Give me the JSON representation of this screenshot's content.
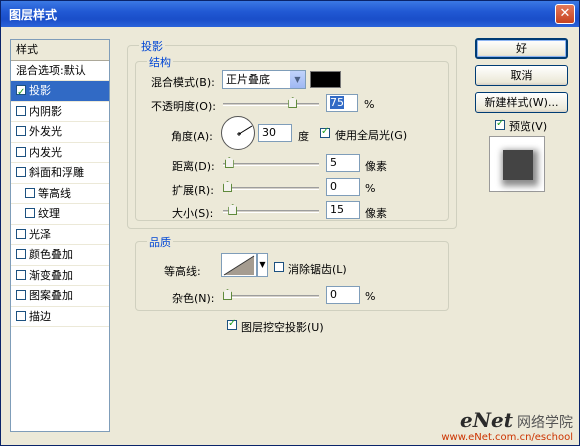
{
  "window": {
    "title": "图层样式",
    "close_glyph": "✕"
  },
  "style_list": {
    "header": "样式",
    "blend_options": "混合选项:默认",
    "items": [
      {
        "label": "投影",
        "checked": true,
        "selected": true,
        "sub": false
      },
      {
        "label": "内阴影",
        "checked": false,
        "selected": false,
        "sub": false
      },
      {
        "label": "外发光",
        "checked": false,
        "selected": false,
        "sub": false
      },
      {
        "label": "内发光",
        "checked": false,
        "selected": false,
        "sub": false
      },
      {
        "label": "斜面和浮雕",
        "checked": false,
        "selected": false,
        "sub": false
      },
      {
        "label": "等高线",
        "checked": false,
        "selected": false,
        "sub": true
      },
      {
        "label": "纹理",
        "checked": false,
        "selected": false,
        "sub": true
      },
      {
        "label": "光泽",
        "checked": false,
        "selected": false,
        "sub": false
      },
      {
        "label": "颜色叠加",
        "checked": false,
        "selected": false,
        "sub": false
      },
      {
        "label": "渐变叠加",
        "checked": false,
        "selected": false,
        "sub": false
      },
      {
        "label": "图案叠加",
        "checked": false,
        "selected": false,
        "sub": false
      },
      {
        "label": "描边",
        "checked": false,
        "selected": false,
        "sub": false
      }
    ]
  },
  "drop_shadow": {
    "title": "投影",
    "structure_title": "结构",
    "blend_mode": {
      "label": "混合模式(B):",
      "value": "正片叠底",
      "color": "#000000"
    },
    "opacity": {
      "label": "不透明度(O):",
      "value": "75",
      "unit": "%",
      "level": 0.75
    },
    "angle": {
      "label": "角度(A):",
      "value": "30",
      "unit": "度",
      "global_light_label": "使用全局光(G)",
      "global_light": true
    },
    "distance": {
      "label": "距离(D):",
      "value": "5",
      "unit": "像素",
      "level": 0.02
    },
    "spread": {
      "label": "扩展(R):",
      "value": "0",
      "unit": "%",
      "level": 0.0
    },
    "size": {
      "label": "大小(S):",
      "value": "15",
      "unit": "像素",
      "level": 0.06
    },
    "quality_title": "品质",
    "contour_label": "等高线:",
    "anti_alias_label": "消除锯齿(L)",
    "anti_alias": false,
    "noise": {
      "label": "杂色(N):",
      "value": "0",
      "unit": "%",
      "level": 0.0
    },
    "knockout_label": "图层挖空投影(U)",
    "knockout": true
  },
  "buttons": {
    "ok": "好",
    "cancel": "取消",
    "new_style": "新建样式(W)...",
    "preview": "预览(V)"
  },
  "preview_checked": true,
  "watermark": {
    "brand": "eNet",
    "brand_cn": "网络学院",
    "url": "www.eNet.com.cn/eschool"
  }
}
